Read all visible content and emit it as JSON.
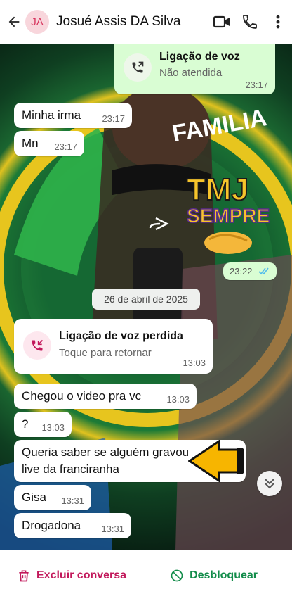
{
  "header": {
    "avatar_initials": "JA",
    "contact_name": "Josué Assis DA Silva",
    "icons": [
      "back-arrow-icon",
      "video-call-icon",
      "voice-call-icon",
      "more-options-icon"
    ]
  },
  "wallpaper": {
    "label_banner": "FAMILIA",
    "sticker_line1": "TMJ",
    "sticker_line2": "SEMPRE"
  },
  "messages": [
    {
      "id": "m1",
      "direction": "out",
      "type": "call",
      "title": "Ligação de voz",
      "subtitle": "Não atendida",
      "time": "23:17"
    },
    {
      "id": "m2",
      "direction": "in",
      "text": "Minha irma",
      "time": "23:17"
    },
    {
      "id": "m3",
      "direction": "in",
      "text": "Mn",
      "time": "23:17"
    },
    {
      "id": "m4",
      "direction": "out",
      "type": "forwarded-media",
      "time": "23:22",
      "status": "read"
    },
    {
      "id": "m5",
      "direction": "in",
      "type": "missed-call",
      "title": "Ligação de voz perdida",
      "subtitle": "Toque para retornar",
      "time": "13:03"
    },
    {
      "id": "m6",
      "direction": "in",
      "text": "Chegou o video pra vc",
      "time": "13:03"
    },
    {
      "id": "m7",
      "direction": "in",
      "text": "?",
      "time": "13:03"
    },
    {
      "id": "m8",
      "direction": "in",
      "text_line1": "Queria saber se alguém gravou",
      "text_line2": "live da franciranha",
      "time": ""
    },
    {
      "id": "m9",
      "direction": "in",
      "text": "Gisa",
      "time": "13:31"
    },
    {
      "id": "m10",
      "direction": "in",
      "text": "Drogadona",
      "time": "13:31"
    }
  ],
  "date_separator": "26 de abril de 2025",
  "footer": {
    "delete_label": "Excluir conversa",
    "unblock_label": "Desbloquear"
  },
  "colors": {
    "accent_red": "#c2185b",
    "accent_green": "#128c4a",
    "outgoing_bubble": "#d9fdd3",
    "read_ticks": "#53bdeb"
  }
}
